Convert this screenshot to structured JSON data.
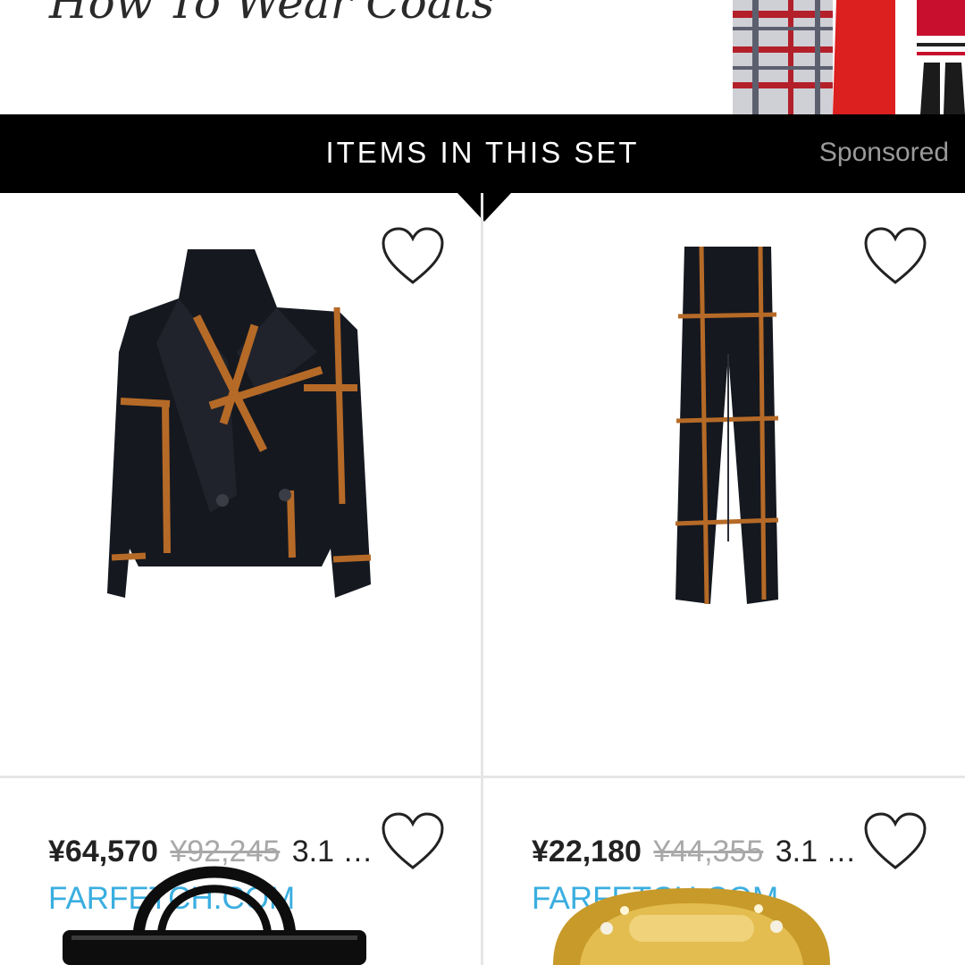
{
  "set": {
    "title": "How To Wear Coats"
  },
  "items_bar": {
    "title": "ITEMS IN THIS SET",
    "sponsored": "Sponsored"
  },
  "items": [
    {
      "price": "¥64,570",
      "original_price": "¥92,245",
      "extra": "3.1 …",
      "store": "FARFETCH.COM",
      "image": "plaid-cropped-coat",
      "favorited": false
    },
    {
      "price": "¥22,180",
      "original_price": "¥44,355",
      "extra": "3.1 …",
      "store": "FARFETCH.COM",
      "image": "plaid-trousers",
      "favorited": false
    },
    {
      "image": "black-patent-handbag",
      "favorited": false
    },
    {
      "image": "gold-jeweled-ring",
      "favorited": false
    }
  ],
  "colors": {
    "bar": "#000000",
    "store_link": "#3aaee0",
    "strike_price": "#a8a8a8"
  }
}
